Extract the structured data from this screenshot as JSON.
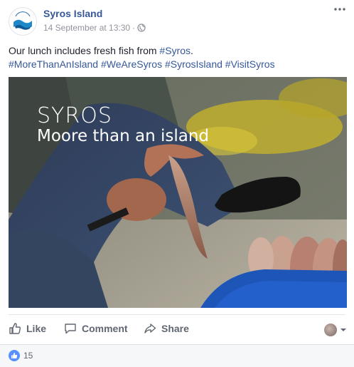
{
  "post": {
    "author": "Syros Island",
    "timestamp": "14 September at 13:30",
    "separator": "·",
    "privacy_icon": "globe-icon",
    "text_prefix": "Our lunch includes fresh fish from ",
    "inline_hashtag": "#Syros",
    "text_suffix": ".",
    "hashtags": [
      "#MoreThanAnIsland",
      "#WeAreSyros",
      "#SyrosIsland",
      "#VisitSyros"
    ]
  },
  "image": {
    "title": "SYROS",
    "subtitle": "Moore than an island"
  },
  "actions": {
    "like": "Like",
    "comment": "Comment",
    "share": "Share"
  },
  "reactions": {
    "count": "15",
    "icon": "thumbs-up-icon"
  },
  "colors": {
    "link": "#365899",
    "like_blue": "#5890ff",
    "muted": "#90949c",
    "action_text": "#606770"
  }
}
